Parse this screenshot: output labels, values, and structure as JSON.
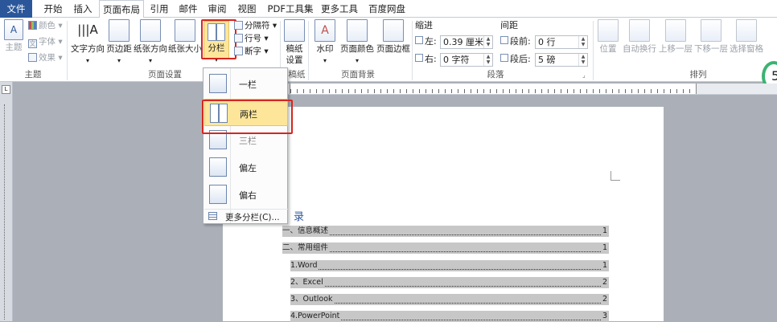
{
  "tabs": [
    "文件",
    "开始",
    "插入",
    "页面布局",
    "引用",
    "邮件",
    "审阅",
    "视图",
    "PDF工具集",
    "更多工具",
    "百度网盘"
  ],
  "ribbon": {
    "themes": {
      "big": "主题",
      "colors": "颜色",
      "fonts": "字体",
      "effects": "效果",
      "group": "主题"
    },
    "page_setup": {
      "text_direction": "文字方向",
      "margins": "页边距",
      "orientation": "纸张方向",
      "size": "纸张大小",
      "columns": "分栏",
      "breaks": "分隔符",
      "line_numbers": "行号",
      "hyphenation": "断字",
      "group": "页面设置"
    },
    "draft": {
      "label1": "稿纸",
      "label2": "设置",
      "group": "稿纸"
    },
    "page_background": {
      "watermark": "水印",
      "page_color": "页面颜色",
      "page_borders": "页面边框",
      "group": "页面背景"
    },
    "paragraph": {
      "indent_title": "缩进",
      "spacing_title": "间距",
      "left_label": "左:",
      "left_value": "0.39 厘米",
      "right_label": "右:",
      "right_value": "0 字符",
      "before_label": "段前:",
      "before_value": "0 行",
      "after_label": "段后:",
      "after_value": "5 磅",
      "group": "段落"
    },
    "arrange": {
      "position": "位置",
      "wrap": "自动换行",
      "forward": "上移一层",
      "backward": "下移一层",
      "selection_pane": "选择窗格",
      "group": "排列"
    }
  },
  "right_edge_badge": "5",
  "columns_menu": {
    "items": [
      "一栏",
      "两栏",
      "三栏",
      "偏左",
      "偏右"
    ],
    "more": "更多分栏(C)...",
    "highlighted": "两栏"
  },
  "document": {
    "toc_title": "录",
    "toc": [
      {
        "text": "一、信息概述",
        "page": "1"
      },
      {
        "text": "二、常用组件",
        "page": "1"
      },
      {
        "text": "1.Word",
        "page": "1"
      },
      {
        "text": "2、Excel",
        "page": "2"
      },
      {
        "text": "3、Outlook",
        "page": "2"
      },
      {
        "text": "4.PowerPoint",
        "page": "3"
      }
    ]
  },
  "colors": {
    "file_tab": "#2b579a",
    "highlight": "#fde69a",
    "annotation_red": "#d7261e"
  }
}
